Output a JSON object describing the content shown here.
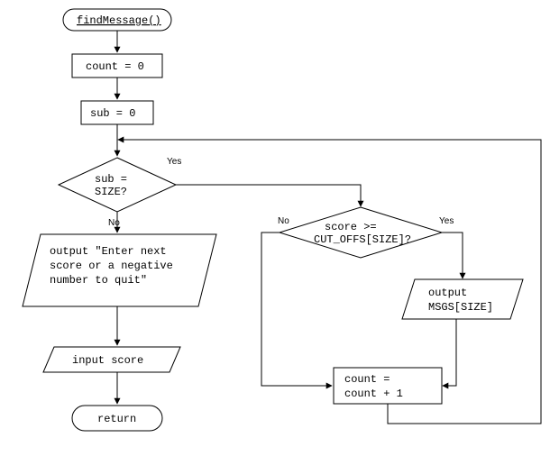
{
  "nodes": {
    "start": {
      "label": "findMessage()"
    },
    "count0": {
      "label": "count = 0"
    },
    "sub0": {
      "label": "sub = 0"
    },
    "decSub": {
      "line1": "sub =",
      "line2": "SIZE?"
    },
    "decScore": {
      "line1": "score >=",
      "line2": "CUT_OFFS[SIZE]?"
    },
    "outPrompt": {
      "line1": "output \"Enter next",
      "line2": "score or a negative",
      "line3": "number to quit\""
    },
    "outMsg": {
      "line1": "output",
      "line2": "MSGS[SIZE]"
    },
    "inScore": {
      "label": "input score"
    },
    "incCount": {
      "line1": "count =",
      "line2": "count + 1"
    },
    "return": {
      "label": "return"
    }
  },
  "edges": {
    "yes": "Yes",
    "no": "No"
  }
}
